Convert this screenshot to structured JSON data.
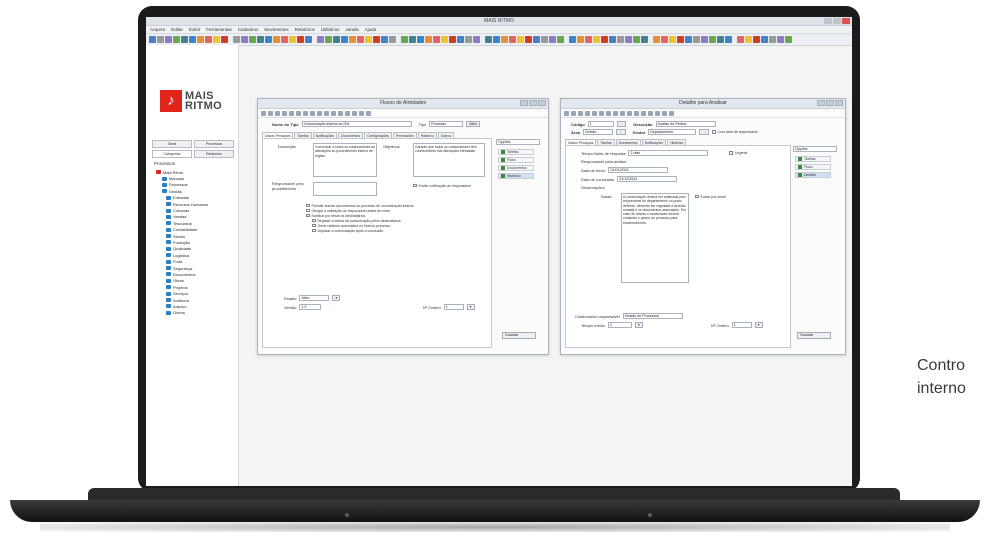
{
  "app": {
    "title": "MAIS RITMO",
    "menu": [
      "Arquivo",
      "Editar",
      "Exibir",
      "Ferramentas",
      "Cadastros",
      "Movimentos",
      "Relatórios",
      "Utilitários",
      "Janela",
      "Ajuda"
    ]
  },
  "brand": {
    "logo_line1": "MAIS",
    "logo_line2": "RITMO",
    "color": "#e2231a"
  },
  "left_panel": {
    "tabs": [
      "Geral",
      "Processos",
      "Categorias",
      "Relatórios"
    ],
    "section": "Processos",
    "tree": [
      {
        "label": "Mais Ritmo",
        "level": 1
      },
      {
        "label": "Manuais",
        "level": 2
      },
      {
        "label": "Processos",
        "level": 2
      },
      {
        "label": "Gestão",
        "level": 2
      },
      {
        "label": "Entradas",
        "level": 3
      },
      {
        "label": "Recursos Humanos",
        "level": 3
      },
      {
        "label": "Compras",
        "level": 3
      },
      {
        "label": "Vendas",
        "level": 3
      },
      {
        "label": "Tesouraria",
        "level": 3
      },
      {
        "label": "Contabilidade",
        "level": 3
      },
      {
        "label": "Stocks",
        "level": 3
      },
      {
        "label": "Produção",
        "level": 3
      },
      {
        "label": "Qualidade",
        "level": 3
      },
      {
        "label": "Logística",
        "level": 3
      },
      {
        "label": "Frota",
        "level": 3
      },
      {
        "label": "Segurança",
        "level": 3
      },
      {
        "label": "Documentos",
        "level": 3
      },
      {
        "label": "Obras",
        "level": 3
      },
      {
        "label": "Projetos",
        "level": 3
      },
      {
        "label": "Serviços",
        "level": 3
      },
      {
        "label": "Auditoria",
        "level": 3
      },
      {
        "label": "Arquivo",
        "level": 3
      },
      {
        "label": "Outros",
        "level": 3
      }
    ]
  },
  "window1": {
    "title": "Fluxos de Atividades",
    "name_label": "Nome do Tipo",
    "name_value": "Comunicação interna ao ISA",
    "type_label": "Tipo",
    "type_value": "Processo",
    "btn_label": "Ativo",
    "tabs": [
      "Dados Principais",
      "Tarefas",
      "Notificações",
      "Documentos",
      "Configurações",
      "Permissões",
      "Histórico",
      "Outros"
    ],
    "desc_label": "Descrição",
    "desc_text": "Comunicar a todos os colaboradores as alterações ao procedimento interno de registo.",
    "obj_label": "Objetivos",
    "obj_text": "Garantir que todos os colaboradores têm conhecimento das alterações efetuadas.",
    "resp_label": "Responsável pelo procedimento",
    "resp_check": "Enviar notificação ao responsável",
    "checks": [
      "Permitir anexar documentos ao processo de comunicação interna",
      "Obrigar a validação do responsável antes do envio",
      "Notificar por email os destinatários",
      "Registar a leitura da comunicação pelos destinatários",
      "Gerar relatório automático no final do processo",
      "Arquivar a comunicação após a conclusão"
    ],
    "state_label": "Estado",
    "state_value": "Ativo",
    "version_label": "Versão",
    "version_value": "1.0",
    "order_label": "Nº Ordem",
    "order_value": "1",
    "side_label": "Opções",
    "side_items": [
      "Tarefas",
      "Fluxo",
      "Documentos",
      "Histórico"
    ],
    "side_button": "Guardar"
  },
  "window2": {
    "title": "Detalhe para Analisar",
    "code_label": "Código",
    "code_value": "1",
    "desc_label": "Descrição",
    "desc_value": "Análise de Pedido",
    "area_label": "Área",
    "area_value": "Gestão",
    "manager_label": "Gestor",
    "manager_value": "Departamento",
    "check_label": "Com área de responsável",
    "tabs": [
      "Dados Principais",
      "Tarefas",
      "Documentos",
      "Notificações",
      "Histórico"
    ],
    "f1_label": "Tempo limite de resposta",
    "f1_value": "2 dias",
    "f1_check": "Urgente",
    "f2_label": "Responsável pela análise",
    "f3_label": "Data de início",
    "f3_value": "01/01/2024",
    "f4_label": "Data de conclusão",
    "f4_value": "31/12/2024",
    "f5_label": "Observações",
    "notes_label": "Notas",
    "notes_text": "A comunicação deverá ser analisada pelo responsável do departamento no prazo definido, devendo ser registada a decisão tomada e os documentos associados. Em caso de dúvida o colaborador deverá contactar o gestor do processo para esclarecimento.",
    "notes_check": "Enviar por email",
    "f6_label": "Colaborador responsável",
    "f6_value": "Gestão de Processos",
    "f7_label": "Tempo médio",
    "f7_value": "1",
    "order_label": "Nº Ordem",
    "order_value": "1",
    "side_label": "Opções",
    "side_items": [
      "Tarefas",
      "Fluxo",
      "Detalhe"
    ],
    "side_button": "Guardar"
  },
  "caption": {
    "line1": "Contro",
    "line2": "interno"
  },
  "colors": {
    "accent": "#e2231a",
    "tree_icon": "#2a7fc4",
    "selected": "#cfe0f4"
  }
}
